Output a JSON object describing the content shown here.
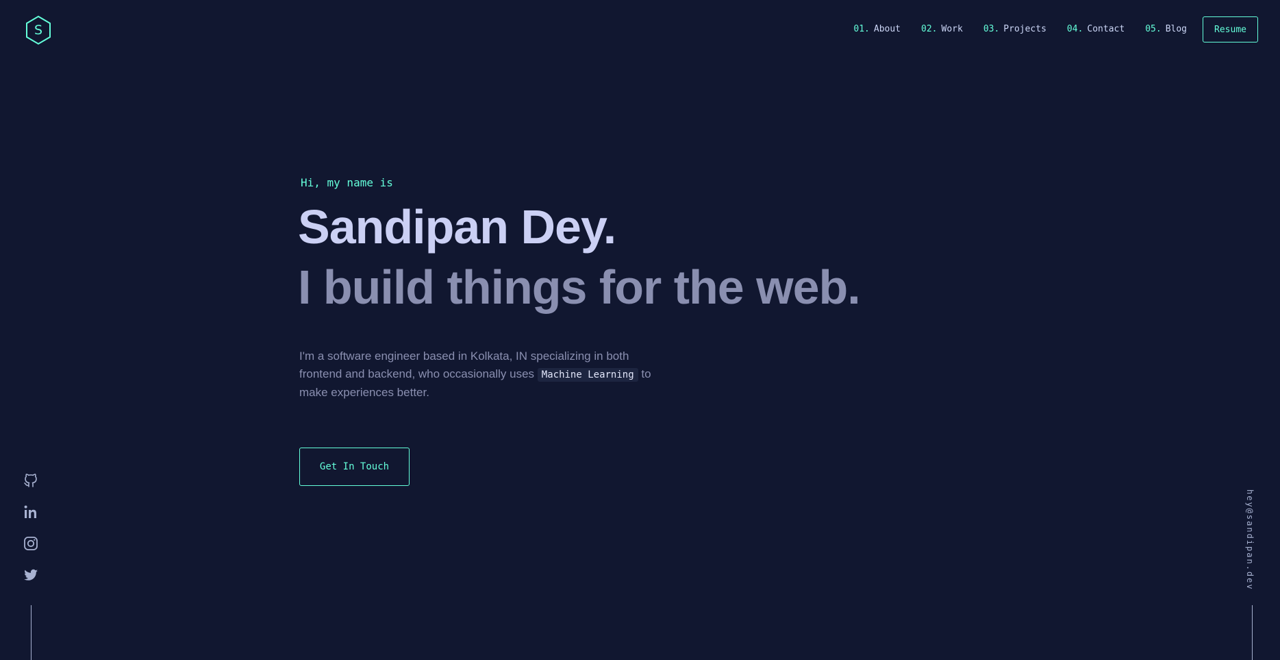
{
  "header": {
    "logo_letter": "S",
    "nav": [
      {
        "num": "01.",
        "label": "About"
      },
      {
        "num": "02.",
        "label": "Work"
      },
      {
        "num": "03.",
        "label": "Projects"
      },
      {
        "num": "04.",
        "label": "Contact"
      },
      {
        "num": "05.",
        "label": "Blog"
      }
    ],
    "resume_label": "Resume"
  },
  "hero": {
    "greeting": "Hi, my name is",
    "name": "Sandipan Dey.",
    "tagline": "I build things for the web.",
    "description_before": "I'm a software engineer based in Kolkata, IN specializing in both frontend and backend, who occasionally uses ",
    "description_highlight": "Machine Learning",
    "description_after": " to make experiences better.",
    "cta_label": "Get In Touch"
  },
  "social": [
    {
      "icon": "github-icon"
    },
    {
      "icon": "linkedin-icon"
    },
    {
      "icon": "instagram-icon"
    },
    {
      "icon": "twitter-icon"
    }
  ],
  "email": "hey@sandipan.dev",
  "colors": {
    "background": "#111730",
    "accent": "#64ffda",
    "heading": "#cbd0f4",
    "muted": "#8a8fb0"
  }
}
